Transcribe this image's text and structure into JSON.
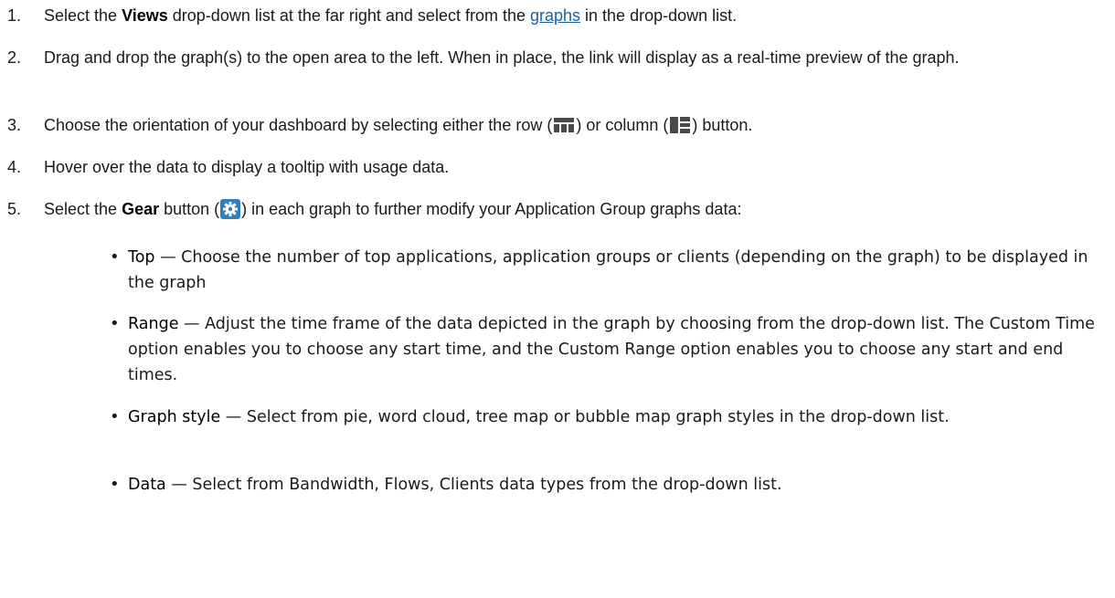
{
  "steps": [
    {
      "number": "1.",
      "pre": "Select the ",
      "kw": "Views",
      "mid": " drop-down list at the far right and select from the ",
      "link": "graphs",
      "post": " in the drop-down list."
    },
    {
      "number": "2.",
      "text": "Drag and drop the graph(s) to the open area to the left. When in place, the link will display as a real-time preview of the graph."
    },
    {
      "number": "3.",
      "pre": "Choose the orientation of your dashboard by selecting either the row (",
      "mid": ") or column (",
      "post": ") button.",
      "icons": [
        "row-layout-icon",
        "column-layout-icon"
      ]
    },
    {
      "number": "4.",
      "text": "Hover over the data to display a tooltip with usage data."
    },
    {
      "number": "5.",
      "pre": "Select the ",
      "kw": "Gear",
      "mid": " button (",
      "post": ") in each graph to further modify your Application Group graphs data:",
      "icons": [
        "gear-icon"
      ]
    }
  ],
  "options": [
    {
      "term": "Top",
      "desc": " — Choose the number of top applications, application groups or clients (depending on the graph) to be displayed in the graph"
    },
    {
      "term": "Range",
      "desc": " — Adjust the time frame of the data depicted in the graph by choosing from the drop-down list. The Custom Time option enables you to choose any start time, and the Custom Range option enables you to choose any start and end times."
    },
    {
      "term": "Graph style",
      "desc": " — Select from pie, word cloud, tree map or bubble map graph styles in the drop-down list."
    },
    {
      "term": "Data",
      "desc": " — Select from Bandwidth, Flows, Clients data types from the drop-down list."
    }
  ],
  "colors": {
    "text": "#1a1a1a",
    "link": "#1a5fa8",
    "icon_dark": "#4a4a4a",
    "gear_blue": "#2e7fc0"
  }
}
